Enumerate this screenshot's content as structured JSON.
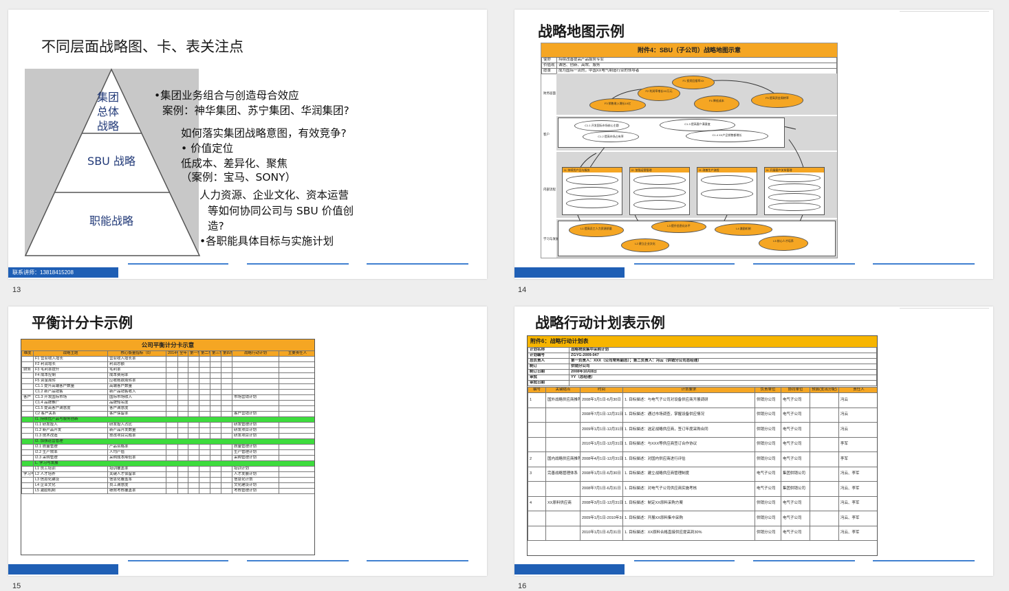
{
  "slides": [
    {
      "number": "13",
      "title": "不同层面战略图、卡、表关注点",
      "pyramid": {
        "top": [
          "集团",
          "总体",
          "战略"
        ],
        "middle": "SBU 战略",
        "bottom": "职能战略"
      },
      "bullets": [
        "•集团业务组合与创造母合效应",
        "案例：神华集团、苏宁集团、华润集团?",
        "如何落实集团战略意图，有效竞争?",
        "• 价值定位",
        "低成本、差异化、聚焦",
        "（案例：宝马、SONY）",
        "人力资源、企业文化、资本运营",
        "等如何协同公司与 SBU 价值创",
        "造?",
        "•各职能具体目标与实施计划"
      ],
      "footer_text": "联系讲师：13818415208"
    },
    {
      "number": "14",
      "title": "战略地图示例",
      "doc_title": "附件4：SBU（子公司）战略地图示意",
      "top_rows": [
        [
          "使命",
          "持续改善提高产品服务专业"
        ],
        [
          "价值观",
          "诚信、创新、高效、服务"
        ],
        [
          "愿景",
          "成为国际一流的，中国XX电气制造行业的领导者"
        ]
      ],
      "bands": [
        "财务层面",
        "客户",
        "内部流程",
        "学习与发展"
      ],
      "finance_ovals": [
        "F1 投资回报率XX",
        "F2 利润率增长XX万元",
        "F3 销售收入增长10亿",
        "F4 降低成本",
        "F5 提高资金周转率"
      ],
      "customer_ovals": [
        "C1.1 开发国际市场核心主题",
        "C1.2 提高市场占有率",
        "C1.3 提高客户满意度",
        "C1.4 XX产品销售额增长"
      ],
      "process_boxes": [
        "I1. 持续优产品与服务",
        "I2. 加强运营管理",
        "I3. 改善生产流程",
        "I4. 开展客户关系管理"
      ],
      "learning_ovals": [
        "L1 提高员工人力资源质量",
        "L2 建立企业文化",
        "L3 提升信息化水平",
        "L4 激励机制",
        "L5 核心人才培养"
      ]
    },
    {
      "number": "15",
      "title": "平衡计分卡示例",
      "doc_title": "公司平衡计分卡示意",
      "headers": [
        "维度",
        "战略主题",
        "核心衡量指标（0）",
        "2014年目标",
        "全年",
        "第一季度",
        "第二季度",
        "第三季度",
        "第四季度",
        "战略行动计划",
        "主要责任人"
      ],
      "rows": [
        [
          "",
          "F1 营业收入增长",
          "营业收入增长率",
          "",
          "",
          "",
          "",
          "",
          "",
          "",
          ""
        ],
        [
          "",
          "F2 利润增长",
          "利润总额",
          "",
          "",
          "",
          "",
          "",
          "",
          "",
          ""
        ],
        [
          "财务",
          "F3 毛利率提升",
          "毛利率",
          "",
          "",
          "",
          "",
          "",
          "",
          "",
          ""
        ],
        [
          "",
          "F4 成本控制",
          "成本费用率",
          "",
          "",
          "",
          "",
          "",
          "",
          "",
          ""
        ],
        [
          "",
          "F5 资金周转",
          "应收账款周转率",
          "",
          "",
          "",
          "",
          "",
          "",
          "",
          ""
        ],
        [
          "",
          "C1.1 提升高端客户数量",
          "高端客户数量",
          "",
          "",
          "",
          "",
          "",
          "",
          "",
          ""
        ],
        [
          "",
          "C1.2 新产品销售",
          "新产品销售收入",
          "",
          "",
          "",
          "",
          "",
          "",
          "",
          ""
        ],
        [
          "客户",
          "C1.3 开发国际市场",
          "国际市场收入",
          "",
          "",
          "",
          "",
          "",
          "",
          "市场营销计划",
          ""
        ],
        [
          "",
          "C1.4 品牌推广",
          "品牌知名度",
          "",
          "",
          "",
          "",
          "",
          "",
          "",
          ""
        ],
        [
          "",
          "C1.5 提高客户满意度",
          "客户满意度",
          "",
          "",
          "",
          "",
          "",
          "",
          "",
          ""
        ],
        [
          "",
          "C2 客户关系",
          "客户保留率",
          "",
          "",
          "",
          "",
          "",
          "",
          "客户营销计划",
          ""
        ]
      ],
      "green1": "I1. 持续优产品与服务创新",
      "rows2": [
        [
          "",
          "I1.1 研发投入",
          "研发投入占比",
          "",
          "",
          "",
          "",
          "",
          "",
          "研发管理计划",
          ""
        ],
        [
          "",
          "I1.2 新产品开发",
          "新产品开发数量",
          "",
          "",
          "",
          "",
          "",
          "",
          "研发项目计划",
          ""
        ],
        [
          "",
          "I1.3 技术改造",
          "技改项目完成率",
          "",
          "",
          "",
          "",
          "",
          "",
          "研发项目计划",
          ""
        ]
      ],
      "green2": "I2. 加强运营管理",
      "rows3": [
        [
          "",
          "I2.1 质量管理",
          "产品合格率",
          "",
          "",
          "",
          "",
          "",
          "",
          "质量管理计划",
          ""
        ],
        [
          "",
          "I2.2 生产效率",
          "人均产值",
          "",
          "",
          "",
          "",
          "",
          "",
          "生产管理计划",
          ""
        ],
        [
          "",
          "I2.3 采购管理",
          "采购成本降低率",
          "",
          "",
          "",
          "",
          "",
          "",
          "采购管理计划",
          ""
        ]
      ],
      "green3": "L. 学习与发展",
      "rows4": [
        [
          "",
          "L1 员工培训",
          "培训覆盖率",
          "",
          "",
          "",
          "",
          "",
          "",
          "培训计划",
          ""
        ],
        [
          "学习与发展",
          "L2 人才培养",
          "关键人才保留率",
          "",
          "",
          "",
          "",
          "",
          "",
          "人才发展计划",
          ""
        ],
        [
          "",
          "L3 信息化建设",
          "信息化覆盖率",
          "",
          "",
          "",
          "",
          "",
          "",
          "信息化计划",
          ""
        ],
        [
          "",
          "L4 企业文化",
          "员工满意度",
          "",
          "",
          "",
          "",
          "",
          "",
          "文化建设计划",
          ""
        ],
        [
          "",
          "L5 激励机制",
          "绩效考核覆盖率",
          "",
          "",
          "",
          "",
          "",
          "",
          "考核管理计划",
          ""
        ]
      ]
    },
    {
      "number": "16",
      "title": "战略行动计划表示例",
      "doc_title": "附件6：战略行动计划表",
      "info_rows": [
        [
          "计划名称",
          "战略物资集中采购计划"
        ],
        [
          "计划编号",
          "ZGYG-2009-047"
        ],
        [
          "总负责人",
          "第一负责人：XXX（公司常务副总）；第二负责人：冯云（供销分公司总经理）"
        ],
        [
          "制订",
          "供销分公司"
        ],
        [
          "制订日期",
          "2008年10月8日"
        ],
        [
          "审批",
          "YY（总经理）"
        ],
        [
          "审批日期",
          ""
        ]
      ],
      "headers": [
        "编号",
        "关键结点",
        "时间",
        "计划要求",
        "负责单位",
        "协同单位",
        "预算(支出分配)",
        "责任人"
      ],
      "rows": [
        [
          "1",
          "国外战略供应商推荐",
          "2008年1月1日-6月30日",
          "1. 目标描述：与电气子公司对设备供应商开展调研",
          "供销分公司",
          "电气子公司",
          "",
          "冯云"
        ],
        [
          "",
          "",
          "2008年7月1日-12月31日",
          "1. 目标描述：通过市场调查，掌握设备供应情况",
          "供销分公司",
          "电气子公司",
          "",
          "冯云"
        ],
        [
          "",
          "",
          "2009年1月1日-12月31日",
          "1. 目标描述：选定战略供应商，签订年度采购合同",
          "供销分公司",
          "电气子公司",
          "",
          "冯云"
        ],
        [
          "",
          "",
          "2010年1月1日-12月31日",
          "1. 目标描述：与XXX等供应商签订合作协议",
          "供销分公司",
          "电气子公司",
          "",
          "李军"
        ],
        [
          "2",
          "国内战略供应商推荐",
          "2008年4月1日-12月31日",
          "1. 目标描述：对国内供应商进行评估",
          "供销分公司",
          "电气子公司",
          "",
          "李军"
        ],
        [
          "3",
          "完善战略管理体系",
          "2008年1月1日-6月30日",
          "1. 目标描述：建立战略供应商管理制度",
          "电气子公司",
          "集团供销公司",
          "",
          "冯云、李军"
        ],
        [
          "",
          "",
          "2008年7月1日-6月31日",
          "1. 目标描述：对电气子公司供应商实施考核",
          "电气子公司",
          "集团供销公司",
          "",
          "冯云、李军"
        ],
        [
          "4",
          "XX原料供应商",
          "2008年3月1日-12月31日",
          "1. 目标描述：制定XX原料采购方案",
          "供销分公司",
          "电气子公司",
          "",
          "冯云、李军"
        ],
        [
          "",
          "",
          "2009年1月1日-2010年3月31日",
          "1. 目标描述：开展XX原料集中采购",
          "供销分公司",
          "电气子公司",
          "",
          "冯云、李军"
        ],
        [
          "",
          "",
          "2010年1月1日-6月31日",
          "1. 目标描述：XX原料合格直接供应提高到30%",
          "供销分公司",
          "电气子公司",
          "",
          "冯云、李军"
        ]
      ]
    }
  ]
}
